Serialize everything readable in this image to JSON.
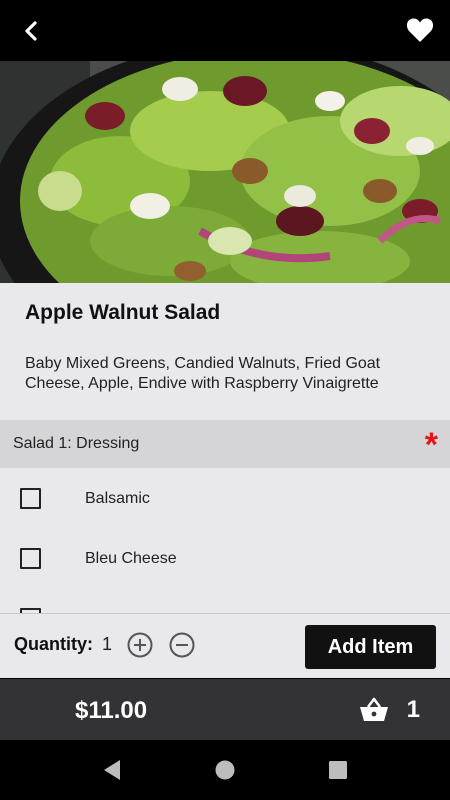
{
  "header": {
    "back_icon": "chevron-left-icon",
    "favorite_icon": "heart-icon"
  },
  "item": {
    "name": "Apple Walnut Salad",
    "description": "Baby Mixed Greens, Candied Walnuts, Fried Goat Cheese, Apple, Endive with Raspberry Vinaigrette"
  },
  "section": {
    "title": "Salad 1: Dressing",
    "required_marker": "*"
  },
  "options": [
    {
      "label": "Balsamic",
      "checked": false
    },
    {
      "label": "Bleu Cheese",
      "checked": false
    },
    {
      "label": "",
      "checked": false
    }
  ],
  "quantity": {
    "label": "Quantity:",
    "value": "1"
  },
  "add_button": {
    "label": "Add Item"
  },
  "footer": {
    "total": "$11.00",
    "cart_count": "1",
    "cart_icon": "basket-icon"
  },
  "colors": {
    "required": "#e8141c",
    "primary_button": "#111111",
    "total_bar": "#333335",
    "panel": "#e8e8ed"
  }
}
